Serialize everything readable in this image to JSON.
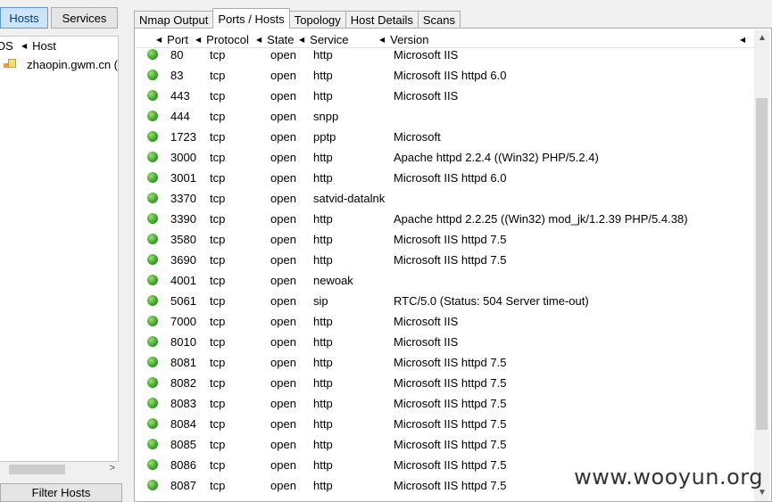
{
  "left_pane": {
    "hosts_button": "Hosts",
    "services_button": "Services",
    "col_os": "OS",
    "col_host": "Host",
    "hosts": [
      {
        "name": "zhaopin.gwm.cn ("
      }
    ],
    "filter_button": "Filter Hosts"
  },
  "tabs": [
    "Nmap Output",
    "Ports / Hosts",
    "Topology",
    "Host Details",
    "Scans"
  ],
  "table": {
    "columns": {
      "port": "Port",
      "protocol": "Protocol",
      "state": "State",
      "service": "Service",
      "version": "Version"
    },
    "rows": [
      {
        "port": "80",
        "protocol": "tcp",
        "state": "open",
        "service": "http",
        "version": "Microsoft IIS"
      },
      {
        "port": "83",
        "protocol": "tcp",
        "state": "open",
        "service": "http",
        "version": "Microsoft IIS httpd 6.0"
      },
      {
        "port": "443",
        "protocol": "tcp",
        "state": "open",
        "service": "http",
        "version": "Microsoft IIS"
      },
      {
        "port": "444",
        "protocol": "tcp",
        "state": "open",
        "service": "snpp",
        "version": ""
      },
      {
        "port": "1723",
        "protocol": "tcp",
        "state": "open",
        "service": "pptp",
        "version": "Microsoft"
      },
      {
        "port": "3000",
        "protocol": "tcp",
        "state": "open",
        "service": "http",
        "version": "Apache httpd 2.2.4 ((Win32) PHP/5.2.4)"
      },
      {
        "port": "3001",
        "protocol": "tcp",
        "state": "open",
        "service": "http",
        "version": "Microsoft IIS httpd 6.0"
      },
      {
        "port": "3370",
        "protocol": "tcp",
        "state": "open",
        "service": "satvid-datalnk",
        "version": ""
      },
      {
        "port": "3390",
        "protocol": "tcp",
        "state": "open",
        "service": "http",
        "version": "Apache httpd 2.2.25 ((Win32) mod_jk/1.2.39 PHP/5.4.38)"
      },
      {
        "port": "3580",
        "protocol": "tcp",
        "state": "open",
        "service": "http",
        "version": "Microsoft IIS httpd 7.5"
      },
      {
        "port": "3690",
        "protocol": "tcp",
        "state": "open",
        "service": "http",
        "version": "Microsoft IIS httpd 7.5"
      },
      {
        "port": "4001",
        "protocol": "tcp",
        "state": "open",
        "service": "newoak",
        "version": ""
      },
      {
        "port": "5061",
        "protocol": "tcp",
        "state": "open",
        "service": "sip",
        "version": "RTC/5.0 (Status: 504 Server time-out)"
      },
      {
        "port": "7000",
        "protocol": "tcp",
        "state": "open",
        "service": "http",
        "version": "Microsoft IIS"
      },
      {
        "port": "8010",
        "protocol": "tcp",
        "state": "open",
        "service": "http",
        "version": "Microsoft IIS"
      },
      {
        "port": "8081",
        "protocol": "tcp",
        "state": "open",
        "service": "http",
        "version": "Microsoft IIS httpd 7.5"
      },
      {
        "port": "8082",
        "protocol": "tcp",
        "state": "open",
        "service": "http",
        "version": "Microsoft IIS httpd 7.5"
      },
      {
        "port": "8083",
        "protocol": "tcp",
        "state": "open",
        "service": "http",
        "version": "Microsoft IIS httpd 7.5"
      },
      {
        "port": "8084",
        "protocol": "tcp",
        "state": "open",
        "service": "http",
        "version": "Microsoft IIS httpd 7.5"
      },
      {
        "port": "8085",
        "protocol": "tcp",
        "state": "open",
        "service": "http",
        "version": "Microsoft IIS httpd 7.5"
      },
      {
        "port": "8086",
        "protocol": "tcp",
        "state": "open",
        "service": "http",
        "version": "Microsoft IIS httpd 7.5"
      },
      {
        "port": "8087",
        "protocol": "tcp",
        "state": "open",
        "service": "http",
        "version": "Microsoft IIS httpd 7.5"
      }
    ]
  },
  "watermark": "www.wooyun.org",
  "colors": {
    "open_status": "#3aa12a",
    "selected_button": "#cce4f7"
  }
}
